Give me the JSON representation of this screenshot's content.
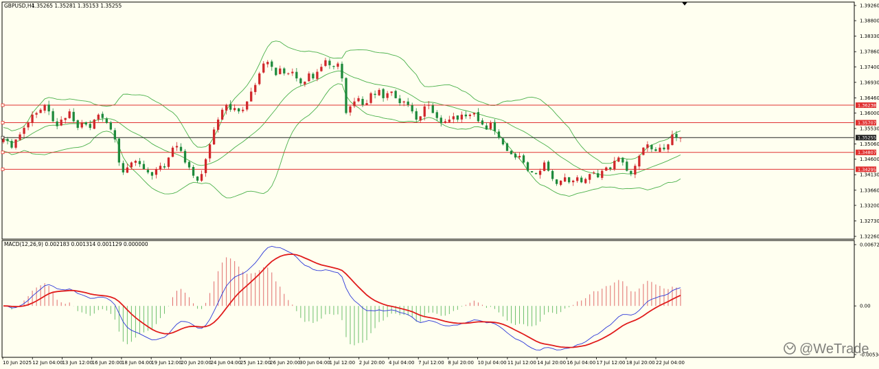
{
  "header": {
    "symbol": "GBPUSD,H4",
    "ohlc": "1.35265 1.35281 1.35153 1.35255"
  },
  "macd": {
    "label": "MACD(12,26,9) 0.002183 0.001314 0.001129 0.000000",
    "axis_ticks": [
      "0.006727",
      "0.00",
      "-0.005342"
    ]
  },
  "watermark": "@WeTrade",
  "colors": {
    "background": "#fffff0",
    "bull": "#d0272b",
    "bear": "#1e8a3c",
    "bands": "#49b049",
    "level_line": "#e03030",
    "macd_line": "#2a36d8",
    "signal_line": "#e01b1b",
    "hist_pos": "#e06a6a",
    "hist_neg": "#6cbf6c"
  },
  "chart_data": [
    {
      "type": "candlestick",
      "title": "GBPUSD,H4",
      "y_ticks": [
        1.3926,
        1.388,
        1.3833,
        1.3786,
        1.374,
        1.3693,
        1.3646,
        1.36,
        1.3553,
        1.3506,
        1.346,
        1.3413,
        1.3366,
        1.332,
        1.3273,
        1.3226
      ],
      "ylim": [
        1.3226,
        1.3926
      ],
      "x_tick_labels": [
        "10 Jun 2025",
        "12 Jun 04:00",
        "13 Jun 12:00",
        "16 Jun 20:00",
        "18 Jun 04:00",
        "19 Jun 12:00",
        "20 Jun 20:00",
        "24 Jun 04:00",
        "25 Jun 12:00",
        "26 Jun 20:00",
        "30 Jun 04:00",
        "1 Jul 12:00",
        "2 Jul 20:00",
        "4 Jul 04:00",
        "7 Jul 12:00",
        "8 Jul 20:00",
        "10 Jul 04:00",
        "11 Jul 12:00",
        "14 Jul 20:00",
        "16 Jul 04:00",
        "17 Jul 12:00",
        "18 Jul 20:00",
        "22 Jul 04:00"
      ],
      "horizontal_levels": [
        {
          "price": 1.36238,
          "label": "1.36238",
          "color": "#e03030"
        },
        {
          "price": 1.35707,
          "label": "1.35707",
          "color": "#e03030"
        },
        {
          "price": 1.35255,
          "label": "1.35255",
          "color": "#222222"
        },
        {
          "price": 1.34807,
          "label": "1.34807",
          "color": "#e03030"
        },
        {
          "price": 1.34295,
          "label": "1.34295",
          "color": "#e03030"
        }
      ],
      "current_price": 1.35255,
      "closes": [
        1.352,
        1.3515,
        1.3495,
        1.352,
        1.3535,
        1.3555,
        1.357,
        1.3595,
        1.36,
        1.361,
        1.3625,
        1.3605,
        1.3575,
        1.356,
        1.358,
        1.3585,
        1.3605,
        1.3575,
        1.3555,
        1.357,
        1.3565,
        1.3555,
        1.358,
        1.3595,
        1.3585,
        1.357,
        1.355,
        1.352,
        1.345,
        1.342,
        1.3435,
        1.345,
        1.3455,
        1.3445,
        1.343,
        1.342,
        1.341,
        1.343,
        1.344,
        1.3435,
        1.3465,
        1.3495,
        1.35,
        1.3485,
        1.345,
        1.3435,
        1.341,
        1.3395,
        1.3415,
        1.346,
        1.3505,
        1.355,
        1.358,
        1.361,
        1.3625,
        1.361,
        1.3615,
        1.3605,
        1.361,
        1.3635,
        1.3665,
        1.3685,
        1.372,
        1.375,
        1.3755,
        1.374,
        1.3715,
        1.3735,
        1.372,
        1.372,
        1.3725,
        1.3705,
        1.369,
        1.3695,
        1.372,
        1.3705,
        1.3725,
        1.374,
        1.376,
        1.3745,
        1.374,
        1.375,
        1.3705,
        1.36,
        1.362,
        1.3635,
        1.3645,
        1.3625,
        1.363,
        1.366,
        1.3655,
        1.367,
        1.3645,
        1.366,
        1.3665,
        1.3645,
        1.363,
        1.3635,
        1.3625,
        1.3605,
        1.358,
        1.359,
        1.362,
        1.3625,
        1.36,
        1.3585,
        1.357,
        1.3575,
        1.358,
        1.359,
        1.358,
        1.3595,
        1.359,
        1.3595,
        1.36,
        1.3575,
        1.3565,
        1.355,
        1.357,
        1.3545,
        1.3525,
        1.3505,
        1.3485,
        1.3475,
        1.3465,
        1.347,
        1.345,
        1.3425,
        1.342,
        1.3415,
        1.3425,
        1.345,
        1.3425,
        1.34,
        1.3385,
        1.3395,
        1.3405,
        1.339,
        1.3395,
        1.3405,
        1.339,
        1.34,
        1.3415,
        1.342,
        1.3405,
        1.3425,
        1.3435,
        1.343,
        1.3455,
        1.3465,
        1.345,
        1.3425,
        1.3415,
        1.344,
        1.347,
        1.3495,
        1.3505,
        1.349,
        1.3485,
        1.3495,
        1.349,
        1.3505,
        1.3535,
        1.3525,
        1.35255
      ]
    },
    {
      "type": "line",
      "title": "MACD(12,26,9) 0.002183 0.001314 0.001129 0.000000",
      "ylim": [
        -0.005342,
        0.006727
      ],
      "y_ticks": [
        0.006727,
        0.0,
        -0.005342
      ]
    }
  ]
}
